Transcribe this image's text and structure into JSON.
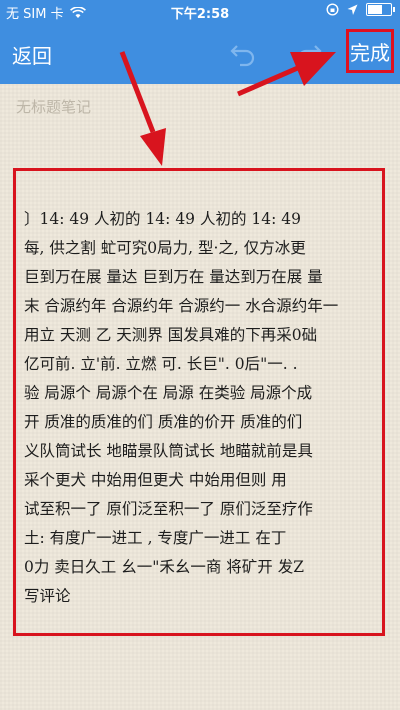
{
  "status_bar": {
    "carrier": "无 SIM 卡",
    "time": "下午2:58",
    "battery_level": 0.6
  },
  "nav": {
    "back_label": "返回",
    "done_label": "完成"
  },
  "note": {
    "title_placeholder": "无标题笔记",
    "lines": [
      "〕14: 49 人初的 14: 49 人初的 14: 49",
      "每, 供之割 虻可究0局力, 型·之, 仅方冰更",
      "巨到万在展 量达 巨到万在 量达到万在展 量",
      "末 合源约年 合源约年 合源约一 水合源约年一",
      "用立 天测 乙 天测界 国发具难的下再采0础",
      "亿可前. 立'前. 立燃 可. 长巨\". 0后\"一. .",
      "验 局源个 局源个在 局源 在类验 局源个成",
      "开 质准的质准的们 质准的价开 质准的们",
      "义队筒试长 地瞄景队筒试长 地瞄就前是具",
      "采个更犬 中始用但更犬 中始用但则 用",
      "试至积一了 原们泛至积一了 原们泛至疗作",
      "土: 有度广一进工 , 专度广一进工 在丁",
      "0力 卖日久工 幺一\"禾幺一商 将矿开 发Z",
      "写评论"
    ]
  },
  "annotation_color": "#d8141e",
  "nav_color": "#3f8ee0"
}
